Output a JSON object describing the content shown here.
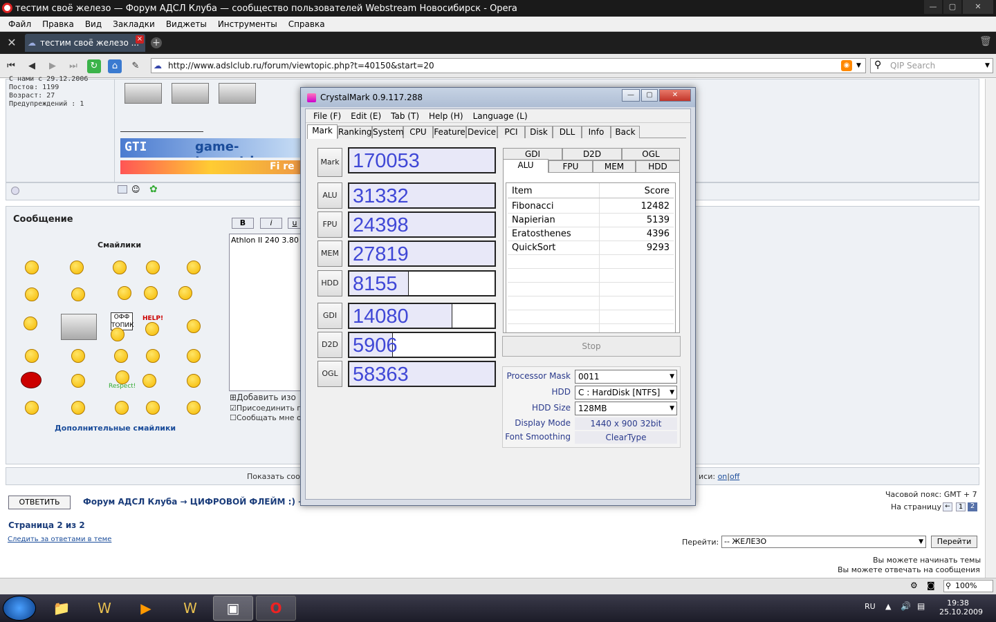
{
  "window_title": "тестим своё железо — Форум АДСЛ Клуба — сообщество пользователей Webstream Новосибирск - Opera",
  "menu": [
    "Файл",
    "Правка",
    "Вид",
    "Закладки",
    "Виджеты",
    "Инструменты",
    "Справка"
  ],
  "tab_title": "тестим своё железо ...",
  "address": "http://www.adslclub.ru/forum/viewtopic.php?t=40150&start=20",
  "search_placeholder": "QIP Search",
  "profile": {
    "line1": "С нами с 29.12.2006",
    "posts": "Постов: 1199",
    "age": "Возраст: 27",
    "warnings": "Предупреждений : 1"
  },
  "banners": {
    "logo_text": "GTI",
    "site": "game-torrent.in",
    "fire": "Fi re"
  },
  "message": {
    "heading": "Сообщение",
    "smileys_heading": "Смайлики",
    "more_smileys": "Дополнительные смайлики",
    "format_buttons": [
      "B",
      "i",
      "u"
    ],
    "text": "Athlon II 240 3.80",
    "add_image": "Добавить изо",
    "check_attach": "Присоединить п",
    "check_notify": "Сообщать мне о",
    "sign_offtopic": "ОФФ ТОПИК",
    "sign_help": "HELP!",
    "sign_respect": "Respect!"
  },
  "show_bar": {
    "left": "Показать соо",
    "right": "иси:",
    "on": "on",
    "off": "off"
  },
  "reply_button": "ОТВЕТИТЬ",
  "breadcrumb": "Форум АДСЛ Клуба → ЦИФРОВОЙ ФЛЕЙМ :) → Ж",
  "timezone": "Часовой пояс: GMT + 7",
  "to_page": "На страницу",
  "pages": [
    "1",
    "2"
  ],
  "page_of": "Страница 2 из 2",
  "watch_topic": "Следить за ответами в теме",
  "jump_label": "Перейти:",
  "jump_value": "-- ЖЕЛЕЗО",
  "jump_button": "Перейти",
  "perm1": "Вы можете начинать темы",
  "perm2": "Вы можете отвечать на сообщения",
  "zoom": "100%",
  "tray": {
    "lang": "RU",
    "time": "19:38",
    "date": "25.10.2009"
  },
  "crystalmark": {
    "title": "CrystalMark 0.9.117.288",
    "menu": [
      "File (F)",
      "Edit (E)",
      "Tab (T)",
      "Help (H)",
      "Language (L)"
    ],
    "tabs": [
      "Mark",
      "Ranking",
      "System",
      "CPU",
      "Feature",
      "Device",
      "PCI",
      "Disk",
      "DLL",
      "Info",
      "Back"
    ],
    "scores": [
      {
        "label": "Mark",
        "value": "170053",
        "fill": 1.0
      },
      {
        "label": "ALU",
        "value": "31332",
        "fill": 1.0
      },
      {
        "label": "FPU",
        "value": "24398",
        "fill": 1.0
      },
      {
        "label": "MEM",
        "value": "27819",
        "fill": 1.0
      },
      {
        "label": "HDD",
        "value": "8155",
        "fill": 0.41
      },
      {
        "label": "GDI",
        "value": "14080",
        "fill": 0.71
      },
      {
        "label": "D2D",
        "value": "5906",
        "fill": 0.3
      },
      {
        "label": "OGL",
        "value": "58363",
        "fill": 1.0
      }
    ],
    "subtabs_top": [
      "GDI",
      "D2D",
      "OGL"
    ],
    "subtabs_bottom": [
      "ALU",
      "FPU",
      "MEM",
      "HDD"
    ],
    "results_header": {
      "item": "Item",
      "score": "Score"
    },
    "results": [
      {
        "item": "Fibonacci",
        "score": "12482"
      },
      {
        "item": "Napierian",
        "score": "5139"
      },
      {
        "item": "Eratosthenes",
        "score": "4396"
      },
      {
        "item": "QuickSort",
        "score": "9293"
      }
    ],
    "stop": "Stop",
    "info": [
      {
        "label": "Processor Mask",
        "value": "0011",
        "type": "select"
      },
      {
        "label": "HDD",
        "value": "C : HardDisk [NTFS]",
        "type": "select"
      },
      {
        "label": "HDD Size",
        "value": "128MB",
        "type": "select"
      },
      {
        "label": "Display Mode",
        "value": "1440 x 900 32bit",
        "type": "text"
      },
      {
        "label": "Font Smoothing",
        "value": "ClearType",
        "type": "text"
      }
    ]
  }
}
